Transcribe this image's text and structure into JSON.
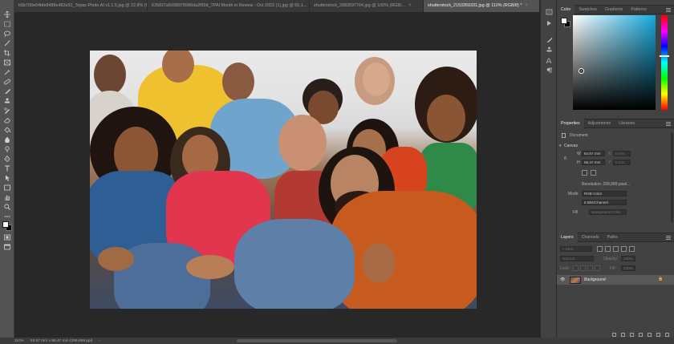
{
  "tabs": [
    {
      "label": "b5b708e04bfe8488e482e52_Topaz Photo AI v1.1.5.jpg @ 22,8% (ff0004859 c...",
      "active": false
    },
    {
      "label": "635827a5098879986da2f50d_TPAI Month in Review - Oct 2022 (1).jpg @ 55,1...",
      "active": false
    },
    {
      "label": "shutterstock_2083597764.jpg @ 100% (RGB/...",
      "active": false
    },
    {
      "label": "shutterstock_2153359331.jpg @ 110% (RGB/8) *",
      "active": true
    }
  ],
  "tab_close": "×",
  "statusbar": {
    "zoom": "110%",
    "doc_info": "84,67 mm x 56,47 mm (299,999 ppi)",
    "arrow": "›"
  },
  "color_panel": {
    "tabs": [
      "Color",
      "Swatches",
      "Gradients",
      "Patterns"
    ],
    "active_tab": "Color",
    "field_hue_hex": "#15aadd",
    "foreground": "#ffffff",
    "background": "#000000"
  },
  "properties_panel": {
    "tabs": [
      "Properties",
      "Adjustments",
      "Libraries"
    ],
    "active_tab": "Properties",
    "kind": "Document",
    "section": "Canvas",
    "w_label": "W",
    "w_value": "84,67 mm",
    "h_label": "H",
    "h_value": "56,47 mm",
    "x_label": "X",
    "x_value": "0 mm",
    "y_label": "Y",
    "y_value": "0 mm",
    "resolution": "Resolution: 299,999 pixel...",
    "mode_label": "Mode",
    "mode_value": "RGB Color",
    "depth_value": "8 Bits/Channel",
    "fill_label": "Fill",
    "fill_value": "Background Color"
  },
  "layers_panel": {
    "tabs": [
      "Layers",
      "Channels",
      "Paths"
    ],
    "active_tab": "Layers",
    "search_placeholder": "Kind",
    "blend_mode": "Normal",
    "opacity_label": "Opacity:",
    "opacity_value": "100%",
    "lock_label": "Lock:",
    "fill_label": "Fill:",
    "fill_value": "100%",
    "layers": [
      {
        "name": "Background",
        "visible": true,
        "locked": true
      }
    ]
  }
}
